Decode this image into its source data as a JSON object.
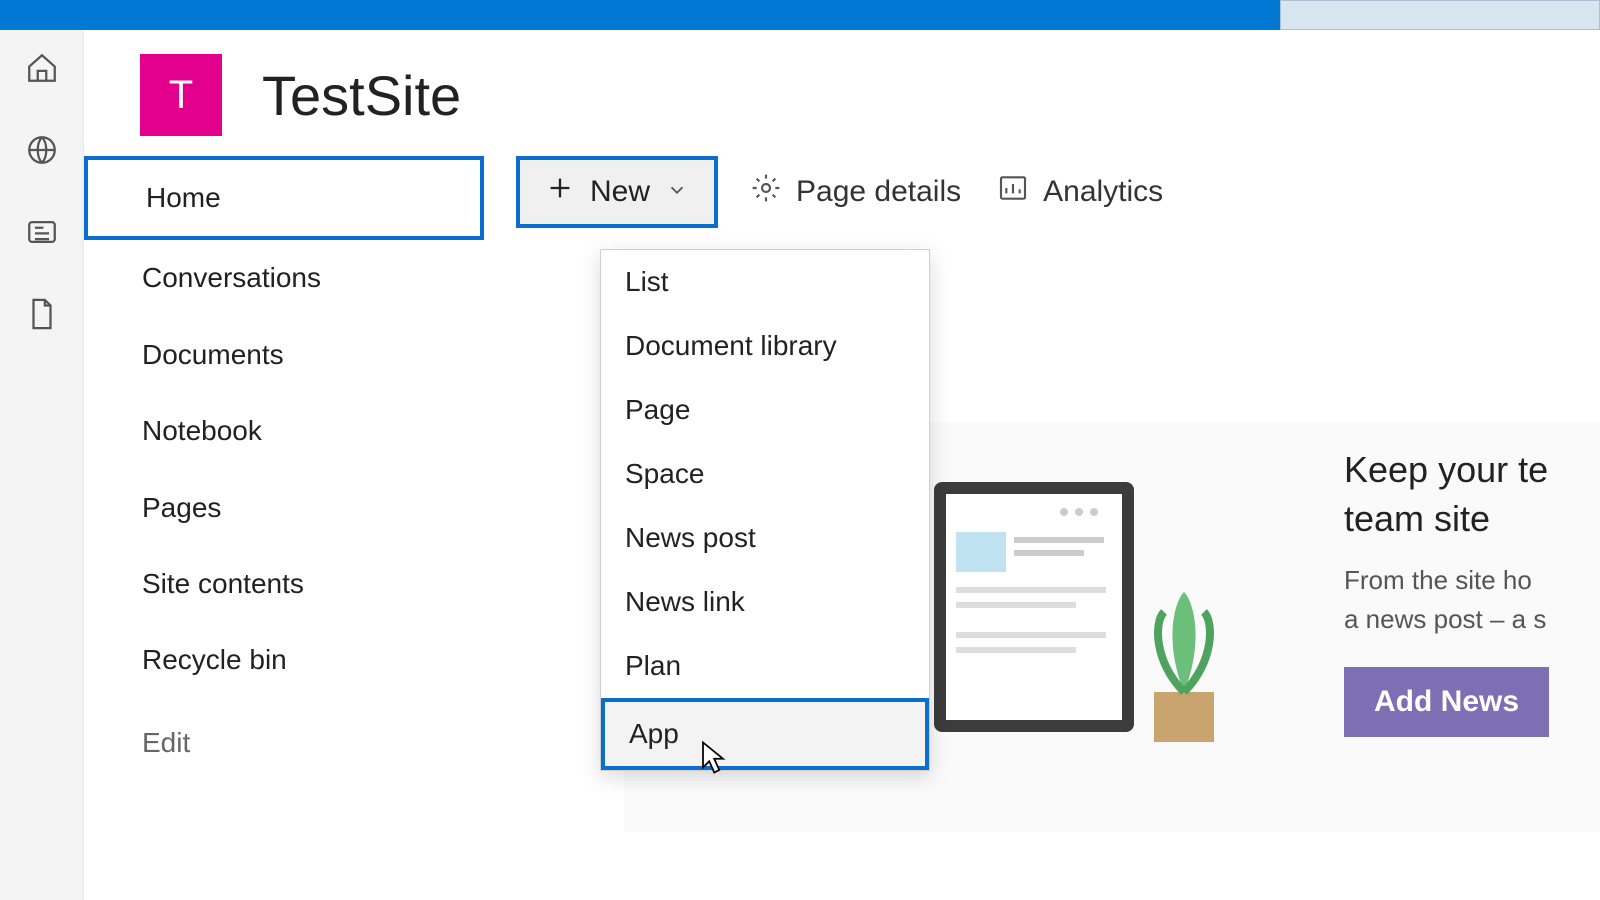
{
  "site": {
    "logo_letter": "T",
    "title": "TestSite"
  },
  "leftnav": {
    "items": [
      {
        "label": "Home",
        "selected": true
      },
      {
        "label": "Conversations"
      },
      {
        "label": "Documents"
      },
      {
        "label": "Notebook"
      },
      {
        "label": "Pages"
      },
      {
        "label": "Site contents"
      },
      {
        "label": "Recycle bin"
      }
    ],
    "edit_label": "Edit"
  },
  "toolbar": {
    "new_label": "New",
    "page_details_label": "Page details",
    "analytics_label": "Analytics"
  },
  "new_dropdown": {
    "items": [
      "List",
      "Document library",
      "Page",
      "Space",
      "News post",
      "News link",
      "Plan",
      "App"
    ],
    "highlighted_index": 7
  },
  "news": {
    "heading_line1": "Keep your te",
    "heading_line2": "team site",
    "desc_line1": "From the site ho",
    "desc_line2": "a news post – a s",
    "add_button_label": "Add News"
  },
  "rail_icons": [
    "home-icon",
    "globe-icon",
    "news-icon",
    "document-icon"
  ]
}
